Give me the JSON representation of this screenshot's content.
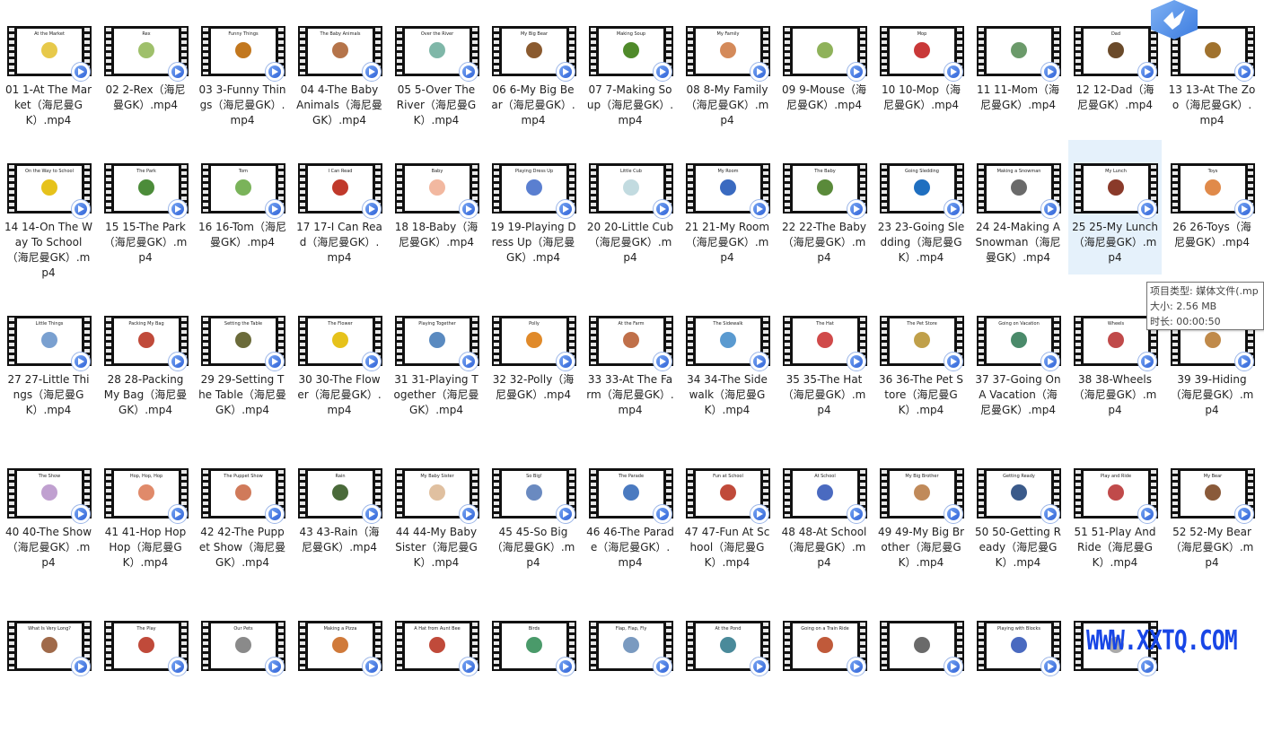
{
  "files": [
    {
      "label": "01 1-At The Market（海尼曼GK）.mp4",
      "thumb": "At the Market",
      "pic": "#e7c94a"
    },
    {
      "label": "02 2-Rex（海尼曼GK）.mp4",
      "thumb": "Rex",
      "pic": "#9fc06b"
    },
    {
      "label": "03 3-Funny Things（海尼曼GK）.mp4",
      "thumb": "Funny Things",
      "pic": "#c2771e"
    },
    {
      "label": "04 4-The Baby Animals（海尼曼GK）.mp4",
      "thumb": "The Baby Animals",
      "pic": "#b5744a"
    },
    {
      "label": "05 5-Over The River（海尼曼GK）.mp4",
      "thumb": "Over the River",
      "pic": "#7fb7a8"
    },
    {
      "label": "06 6-My Big Bear（海尼曼GK）.mp4",
      "thumb": "My Big Bear",
      "pic": "#8a5a2f"
    },
    {
      "label": "07 7-Making Soup（海尼曼GK）.mp4",
      "thumb": "Making Soup",
      "pic": "#4f8a2a"
    },
    {
      "label": "08 8-My Family（海尼曼GK）.mp4",
      "thumb": "My Family",
      "pic": "#d48a5a"
    },
    {
      "label": "09 9-Mouse（海尼曼GK）.mp4",
      "thumb": "",
      "pic": "#8fb25a"
    },
    {
      "label": "10 10-Mop（海尼曼GK）.mp4",
      "thumb": "Mop",
      "pic": "#c93838"
    },
    {
      "label": "11 11-Mom（海尼曼GK）.mp4",
      "thumb": "",
      "pic": "#6b9a6a"
    },
    {
      "label": "12 12-Dad（海尼曼GK）.mp4",
      "thumb": "Dad",
      "pic": "#6a4a2a"
    },
    {
      "label": "13 13-At The Zoo（海尼曼GK）.mp4",
      "thumb": "",
      "pic": "#a0722e"
    },
    {
      "label": "14 14-On The Way To School（海尼曼GK）.mp4",
      "thumb": "On the Way to School",
      "pic": "#e6c21b"
    },
    {
      "label": "15 15-The Park（海尼曼GK）.mp4",
      "thumb": "The Park",
      "pic": "#4c8c3a"
    },
    {
      "label": "16 16-Tom（海尼曼GK）.mp4",
      "thumb": "Tom",
      "pic": "#7ab35a"
    },
    {
      "label": "17 17-I Can Read（海尼曼GK）.mp4",
      "thumb": "I Can Read",
      "pic": "#c0392b"
    },
    {
      "label": "18 18-Baby（海尼曼GK）.mp4",
      "thumb": "Baby",
      "pic": "#f2b8a0"
    },
    {
      "label": "19 19-Playing Dress Up（海尼曼GK）.mp4",
      "thumb": "Playing Dress Up",
      "pic": "#5a7fd0"
    },
    {
      "label": "20 20-Little Cub（海尼曼GK）.mp4",
      "thumb": "Little Cub",
      "pic": "#c2dbe0"
    },
    {
      "label": "21 21-My Room（海尼曼GK）.mp4",
      "thumb": "My Room",
      "pic": "#3a6ac0"
    },
    {
      "label": "22 22-The Baby（海尼曼GK）.mp4",
      "thumb": "The Baby",
      "pic": "#5a8a3a"
    },
    {
      "label": "23 23-Going Sledding（海尼曼GK）.mp4",
      "thumb": "Going Sledding",
      "pic": "#1f6fc0"
    },
    {
      "label": "24 24-Making A Snowman（海尼曼GK）.mp4",
      "thumb": "Making a Snowman",
      "pic": "#6a6a6a"
    },
    {
      "label": "25 25-My Lunch（海尼曼GK）.mp4",
      "thumb": "My Lunch",
      "pic": "#8a3a2a"
    },
    {
      "label": "26 26-Toys（海尼曼GK）.mp4",
      "thumb": "Toys",
      "pic": "#e08a4a"
    },
    {
      "label": "27 27-Little Things（海尼曼GK）.mp4",
      "thumb": "Little Things",
      "pic": "#7aa0d0"
    },
    {
      "label": "28 28-Packing My Bag（海尼曼GK）.mp4",
      "thumb": "Packing My Bag",
      "pic": "#c04a3a"
    },
    {
      "label": "29 29-Setting The Table（海尼曼GK）.mp4",
      "thumb": "Setting the Table",
      "pic": "#6b6b3a"
    },
    {
      "label": "30 30-The Flower（海尼曼GK）.mp4",
      "thumb": "The Flower",
      "pic": "#e6c21b"
    },
    {
      "label": "31 31-Playing Together（海尼曼GK）.mp4",
      "thumb": "Playing Together",
      "pic": "#5a8ac0"
    },
    {
      "label": "32 32-Polly（海尼曼GK）.mp4",
      "thumb": "Polly",
      "pic": "#e08a2a"
    },
    {
      "label": "33 33-At The Farm（海尼曼GK）.mp4",
      "thumb": "At the Farm",
      "pic": "#c0704a"
    },
    {
      "label": "34 34-The Sidewalk（海尼曼GK）.mp4",
      "thumb": "The Sidewalk",
      "pic": "#5a9ad0"
    },
    {
      "label": "35 35-The Hat（海尼曼GK）.mp4",
      "thumb": "The Hat",
      "pic": "#d04a4a"
    },
    {
      "label": "36 36-The Pet Store（海尼曼GK）.mp4",
      "thumb": "The Pet Store",
      "pic": "#c0a04a"
    },
    {
      "label": "37 37-Going On A Vacation（海尼曼GK）.mp4",
      "thumb": "Going on Vacation",
      "pic": "#4a8a6a"
    },
    {
      "label": "38 38-Wheels（海尼曼GK）.mp4",
      "thumb": "Wheels",
      "pic": "#c04a4a"
    },
    {
      "label": "39 39-Hiding（海尼曼GK）.mp4",
      "thumb": "",
      "pic": "#c08a4a"
    },
    {
      "label": "40 40-The Show（海尼曼GK）.mp4",
      "thumb": "The Show",
      "pic": "#c0a0d0"
    },
    {
      "label": "41 41-Hop Hop Hop（海尼曼GK）.mp4",
      "thumb": "Hop, Hop, Hop",
      "pic": "#e08a6a"
    },
    {
      "label": "42 42-The Puppet Show（海尼曼GK）.mp4",
      "thumb": "The Puppet Show",
      "pic": "#d07a5a"
    },
    {
      "label": "43 43-Rain（海尼曼GK）.mp4",
      "thumb": "Rain",
      "pic": "#4a6a3a"
    },
    {
      "label": "44 44-My Baby Sister（海尼曼GK）.mp4",
      "thumb": "My Baby Sister",
      "pic": "#e0c0a0"
    },
    {
      "label": "45 45-So Big（海尼曼GK）.mp4",
      "thumb": "So Big!",
      "pic": "#6a8ac0"
    },
    {
      "label": "46 46-The Parade（海尼曼GK）.mp4",
      "thumb": "The Parade",
      "pic": "#4a7ac0"
    },
    {
      "label": "47 47-Fun At School（海尼曼GK）.mp4",
      "thumb": "Fun at School",
      "pic": "#c04a3a"
    },
    {
      "label": "48 48-At School（海尼曼GK）.mp4",
      "thumb": "At School",
      "pic": "#4a6ac0"
    },
    {
      "label": "49 49-My Big Brother（海尼曼GK）.mp4",
      "thumb": "My Big Brother",
      "pic": "#c08a5a"
    },
    {
      "label": "50 50-Getting Ready（海尼曼GK）.mp4",
      "thumb": "Getting Ready",
      "pic": "#3a5a8a"
    },
    {
      "label": "51 51-Play And Ride（海尼曼GK）.mp4",
      "thumb": "Play and Ride",
      "pic": "#c04a4a"
    },
    {
      "label": "52 52-My Bear（海尼曼GK）.mp4",
      "thumb": "My Bear",
      "pic": "#8a5a3a"
    },
    {
      "label": "",
      "thumb": "What Is Very Long?",
      "pic": "#a06a4a"
    },
    {
      "label": "",
      "thumb": "The Play",
      "pic": "#c04a3a"
    },
    {
      "label": "",
      "thumb": "Our Pets",
      "pic": "#8a8a8a"
    },
    {
      "label": "",
      "thumb": "Making a Pizza",
      "pic": "#d07a3a"
    },
    {
      "label": "",
      "thumb": "A Hat from Aunt Bee",
      "pic": "#c04a3a"
    },
    {
      "label": "",
      "thumb": "Birds",
      "pic": "#4a9a6a"
    },
    {
      "label": "",
      "thumb": "Flap, Flap, Fly",
      "pic": "#7a9ac0"
    },
    {
      "label": "",
      "thumb": "At the Pond",
      "pic": "#4a8a9a"
    },
    {
      "label": "",
      "thumb": "Going on a Train Ride",
      "pic": "#c05a3a"
    },
    {
      "label": "",
      "thumb": "",
      "pic": "#6a6a6a"
    },
    {
      "label": "",
      "thumb": "Playing with Blocks",
      "pic": "#4a6ac0"
    },
    {
      "label": "",
      "thumb": "",
      "pic": "#aaaaaa"
    }
  ],
  "selected_index": 24,
  "tooltip": {
    "type": "项目类型: 媒体文件(.mp",
    "size": "大小: 2.56 MB",
    "duration": "时长: 00:00:50"
  },
  "watermark": "WWW.XXTQ.COM",
  "icons": {
    "play_badge": "play-badge-icon",
    "app_bird": "bird-logo-icon"
  },
  "colors": {
    "selection": "#e5f1fb",
    "badge": "#2f63d8",
    "watermark": "#1846e6"
  }
}
